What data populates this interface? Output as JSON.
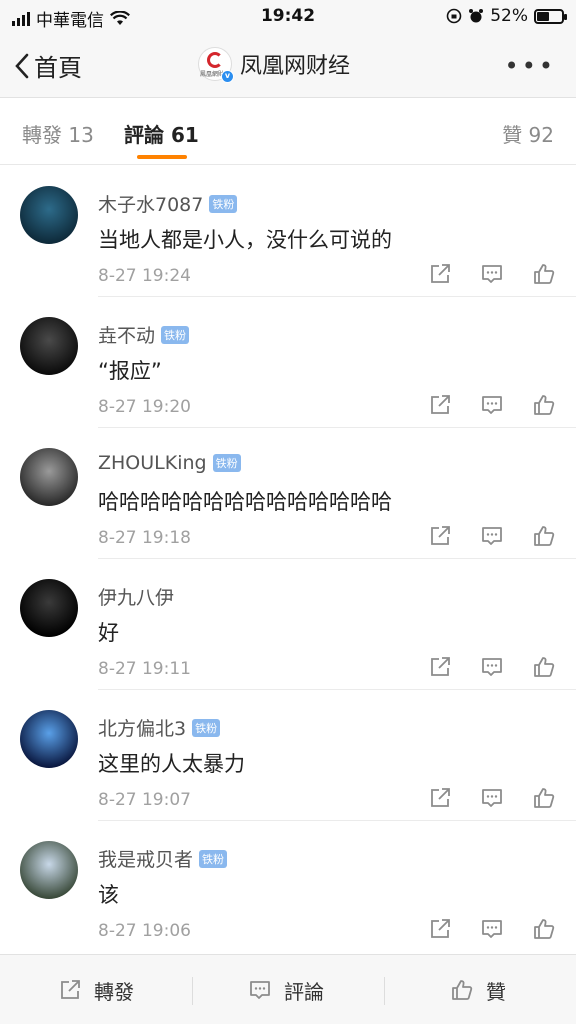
{
  "status": {
    "carrier": "中華電信",
    "time": "19:42",
    "battery": "52%",
    "battery_level": 0.52
  },
  "nav": {
    "back_label": "首頁",
    "account_name": "凤凰网财经",
    "logo_text": "鳳凰網財經",
    "more_label": "•••"
  },
  "tabs": {
    "repost": "轉發 13",
    "comment": "評論 61",
    "like": "贊 92"
  },
  "comments": [
    {
      "name": "木子水7087",
      "badge": "铁粉",
      "text": "当地人都是小人，没什么可说的",
      "time": "8-27 19:24",
      "avatar_colors": [
        "#2d6b8a",
        "#0e2a3a"
      ]
    },
    {
      "name": "垚不动",
      "badge": "铁粉",
      "text": "“报应”",
      "time": "8-27 19:20",
      "avatar_colors": [
        "#4a4a4a",
        "#0b0b0b"
      ]
    },
    {
      "name": "ZHOULKing",
      "badge": "铁粉",
      "text": "哈哈哈哈哈哈哈哈哈哈哈哈哈哈",
      "time": "8-27 19:18",
      "avatar_colors": [
        "#9a9a9a",
        "#2a2a2a"
      ]
    },
    {
      "name": "伊九八伊",
      "badge": "",
      "text": "好",
      "time": "8-27 19:11",
      "avatar_colors": [
        "#3a3a3a",
        "#000000"
      ]
    },
    {
      "name": "北方偏北3",
      "badge": "铁粉",
      "text": "这里的人太暴力",
      "time": "8-27 19:07",
      "avatar_colors": [
        "#5aa0e8",
        "#0a1840"
      ]
    },
    {
      "name": "我是戒贝者",
      "badge": "铁粉",
      "text": "该",
      "time": "8-27 19:06",
      "avatar_colors": [
        "#c8d8e8",
        "#3a4a3a"
      ]
    }
  ],
  "bottom": {
    "repost": "轉發",
    "comment": "評論",
    "like": "贊"
  }
}
